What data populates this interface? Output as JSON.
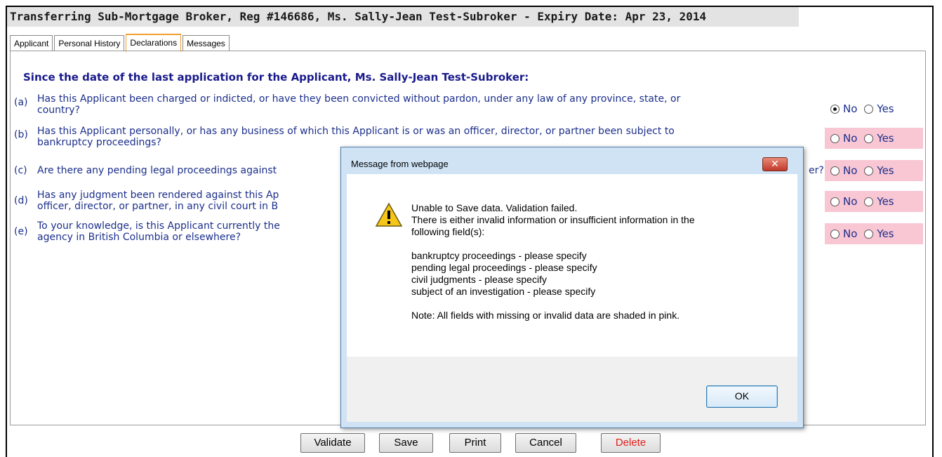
{
  "header": {
    "title": "Transferring Sub-Mortgage Broker, Reg #146686, Ms. Sally-Jean Test-Subroker - Expiry Date: Apr 23, 2014"
  },
  "tabs": [
    {
      "label": "Applicant"
    },
    {
      "label": "Personal History"
    },
    {
      "label": "Declarations"
    },
    {
      "label": "Messages"
    }
  ],
  "declarations": {
    "intro": "Since the date of the last application for the Applicant, Ms. Sally-Jean Test-Subroker:",
    "questions": [
      {
        "letter": "(a)",
        "line1": "Has this Applicant been charged or indicted, or have they been convicted without pardon, under any law of any province, state, or",
        "line2": "country?",
        "selected": "No"
      },
      {
        "letter": "(b)",
        "line1": "Has this Applicant personally, or has any business of which this Applicant is or was an officer, director, or partner been subject to",
        "line2": "bankruptcy proceedings?",
        "selected": ""
      },
      {
        "letter": "(c)",
        "line1": "Are there any pending legal proceedings against",
        "line2": "",
        "trail": "er?",
        "selected": ""
      },
      {
        "letter": "(d)",
        "line1": "Has any judgment been rendered against this Ap",
        "line2": "officer, director, or partner, in any civil court in B",
        "selected": ""
      },
      {
        "letter": "(e)",
        "line1": "To your knowledge, is this Applicant currently the",
        "line2": "agency in British Columbia or elsewhere?",
        "selected": ""
      }
    ],
    "no_label": "No",
    "yes_label": "Yes"
  },
  "buttons": {
    "validate": "Validate",
    "save": "Save",
    "print": "Print",
    "cancel": "Cancel",
    "delete": "Delete"
  },
  "dialog": {
    "title": "Message from webpage",
    "close": "✕",
    "lines": [
      "Unable to Save data. Validation failed.",
      "There is either invalid information or insufficient information in the",
      "following field(s):",
      "",
      "bankruptcy proceedings - please specify",
      "pending legal proceedings - please specify",
      "civil judgments - please specify",
      "subject of an investigation - please specify",
      "",
      "Note: All fields with missing or invalid data are shaded in pink."
    ],
    "ok": "OK"
  }
}
